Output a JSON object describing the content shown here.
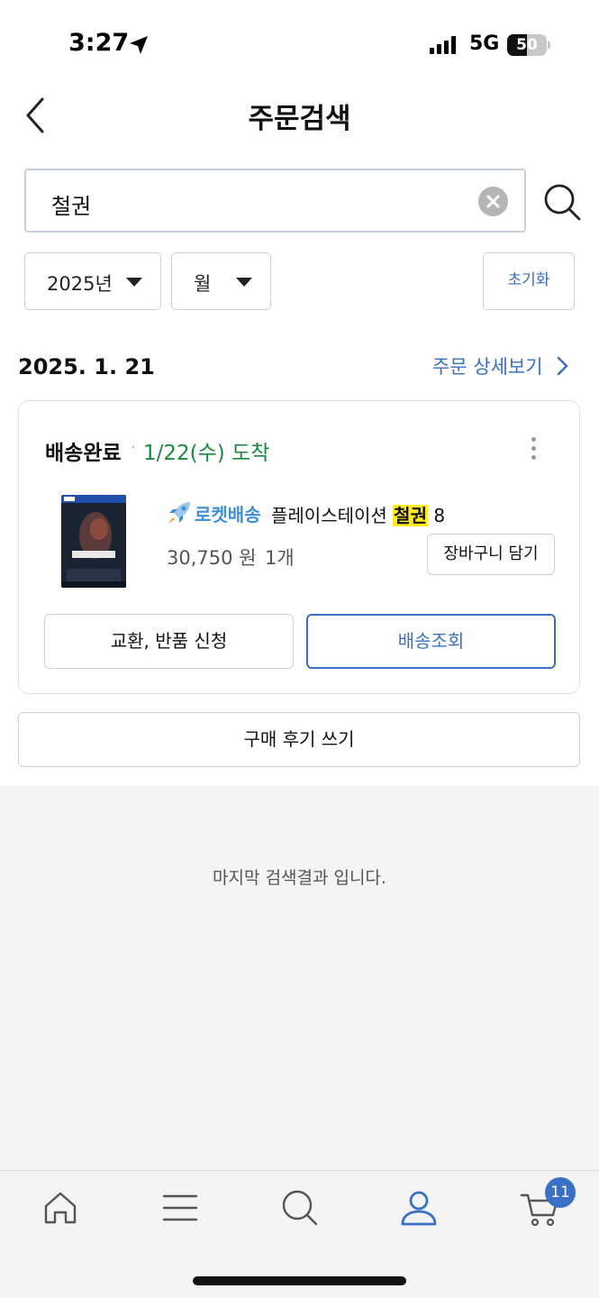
{
  "status_bar": {
    "time": "3:27",
    "network": "5G",
    "battery": "50",
    "battery_level": 0.5
  },
  "header": {
    "title": "주문검색",
    "back_icon": "chevron-left-icon"
  },
  "search": {
    "value": "철권",
    "clear_icon": "clear-circle-icon",
    "search_icon": "search-icon"
  },
  "filters": {
    "year": "2025년",
    "month": "월",
    "reset_label": "초기화"
  },
  "order": {
    "date": "2025. 1. 21",
    "detail_link": "주문 상세보기",
    "status": "배송완료",
    "arrival": "1/22(수) 도착",
    "product": {
      "badge": "로켓배송",
      "name_before": "플레이스테이션 ",
      "name_highlight": "철권",
      "name_after": " 8",
      "price": "30,750 원",
      "quantity": "1개"
    },
    "cart_add_label": "장바구니 담기",
    "return_label": "교환, 반품 신청",
    "track_label": "배송조회"
  },
  "review_label": "구매 후기 쓰기",
  "end_message": "마지막 검색결과 입니다.",
  "tab_bar": {
    "items": [
      "home-icon",
      "menu-icon",
      "search-icon",
      "my-page-icon",
      "cart-icon"
    ],
    "active": "my-page-icon",
    "cart_count": "11"
  },
  "colors": {
    "accent": "#3a6fc6",
    "arrival_green": "#1b8a3e",
    "rocket_blue": "#3d8fd6",
    "highlight": "#ffec1c"
  }
}
